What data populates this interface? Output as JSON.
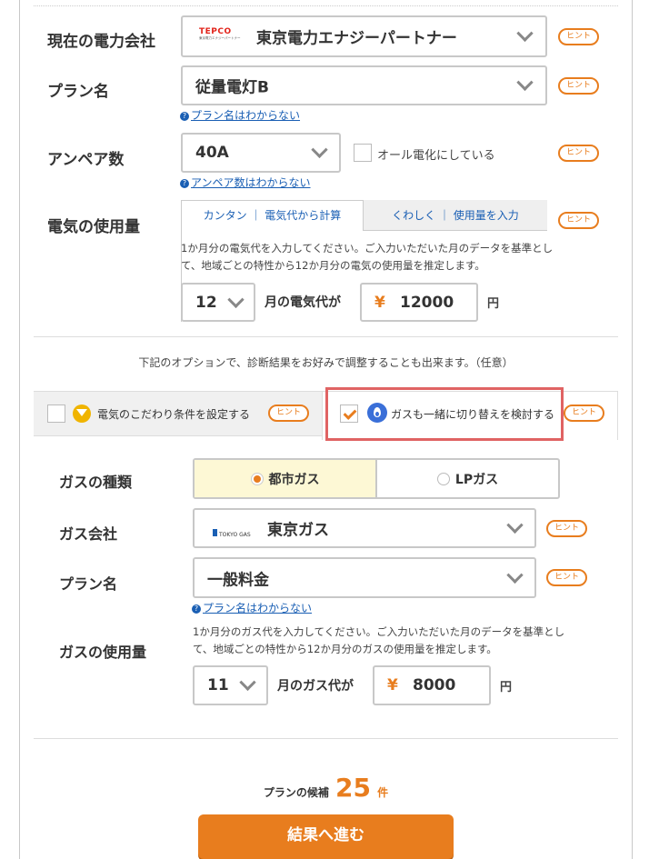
{
  "electric": {
    "company_label": "現在の電力会社",
    "company_logo_text": "TEPCO",
    "company_logo_sub": "東京電力エナジーパートナー",
    "company_value": "東京電力エナジーパートナー",
    "plan_label": "プラン名",
    "plan_value": "従量電灯B",
    "plan_unknown_link": "プラン名はわからない",
    "ampere_label": "アンペア数",
    "ampere_value": "40A",
    "all_electric_label": "オール電化にしている",
    "ampere_unknown_link": "アンペア数はわからない",
    "usage_label": "電気の使用量",
    "tab_easy": "カンタン ｜ 電気代から計算",
    "tab_detail": "くわしく ｜ 使用量を入力",
    "usage_desc_line1": "1か月分の電気代を入力してください。ご入力いただいた月のデータを基準とし",
    "usage_desc_line2": "て、地域ごとの特性から12か月分の電気の使用量を推定します。",
    "month_value": "12",
    "bill_label": "月の電気代が",
    "yen_symbol": "¥",
    "bill_value": "12000",
    "yen_unit": "円"
  },
  "hint_label": "ヒント",
  "options": {
    "intro": "下記のオプションで、診断結果をお好みで調整することも出来ます。（任意）",
    "preference_label": "電気のこだわり条件を設定する",
    "gas_switch_label": "ガスも一緒に切り替えを検討する",
    "gas_switch_checked": true
  },
  "gas": {
    "type_label": "ガスの種類",
    "type_city": "都市ガス",
    "type_lp": "LPガス",
    "type_selected": "都市ガス",
    "company_label": "ガス会社",
    "company_logo_text": "TOKYO GAS",
    "company_value": "東京ガス",
    "plan_label": "プラン名",
    "plan_value": "一般料金",
    "plan_unknown_link": "プラン名はわからない",
    "usage_label": "ガスの使用量",
    "usage_desc_line1": "1か月分のガス代を入力してください。ご入力いただいた月のデータを基準とし",
    "usage_desc_line2": "て、地域ごとの特性から12か月分のガスの使用量を推定します。",
    "month_value": "11",
    "bill_label": "月のガス代が",
    "yen_symbol": "¥",
    "bill_value": "8000",
    "yen_unit": "円"
  },
  "result": {
    "candidates_prefix": "プランの候補",
    "candidates_count": "25",
    "candidates_suffix": "件",
    "submit_label": "結果へ進む"
  },
  "colors": {
    "accent": "#e87d1e",
    "selected_bg": "#fdf8d5",
    "link": "#1a5fb4",
    "highlight_border": "#e06363",
    "gas_icon": "#3a6fd8"
  }
}
